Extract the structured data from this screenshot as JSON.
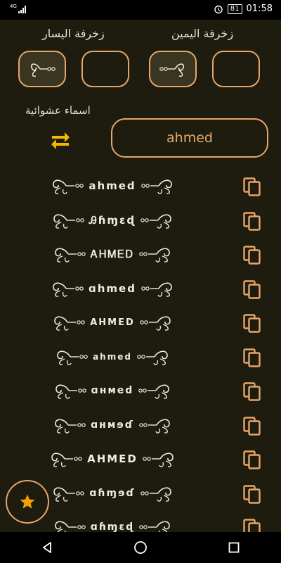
{
  "status_bar": {
    "network": "4G",
    "battery": "81",
    "time": "01:58"
  },
  "decoration": {
    "left_label": "زخرفة اليسار",
    "right_label": "زخرفة اليمين"
  },
  "random_names_label": "اسماء عشوائية",
  "name_input": {
    "value": "ahmed"
  },
  "results": [
    {
      "text": "ahmed",
      "size": 15
    },
    {
      "text": "Ꭿɦɱɛɖ",
      "size": 15
    },
    {
      "text": "ᎪᎻᎷᎬᎠ",
      "size": 15
    },
    {
      "text": "ɑhmed",
      "size": 15
    },
    {
      "text": "AHMED",
      "size": 13
    },
    {
      "text": "ahmed",
      "size": 12
    },
    {
      "text": "ɑнмed",
      "size": 14
    },
    {
      "text": "ɑнмɘɗ",
      "size": 14
    },
    {
      "text": "AHMED",
      "size": 15
    },
    {
      "text": "ɑɦɱɘɗ",
      "size": 14
    },
    {
      "text": "ɑɦɱɛɖ",
      "size": 14
    }
  ],
  "icons": {
    "copy": "copy-icon",
    "shuffle": "shuffle-icon",
    "favorite": "star-icon",
    "back": "nav-back-icon",
    "home": "nav-home-icon",
    "recents": "nav-recents-icon"
  },
  "colors": {
    "background": "#1d1c0e",
    "accent": "#e8a56a",
    "shuffle": "#f5b800",
    "star": "#f5a000"
  }
}
